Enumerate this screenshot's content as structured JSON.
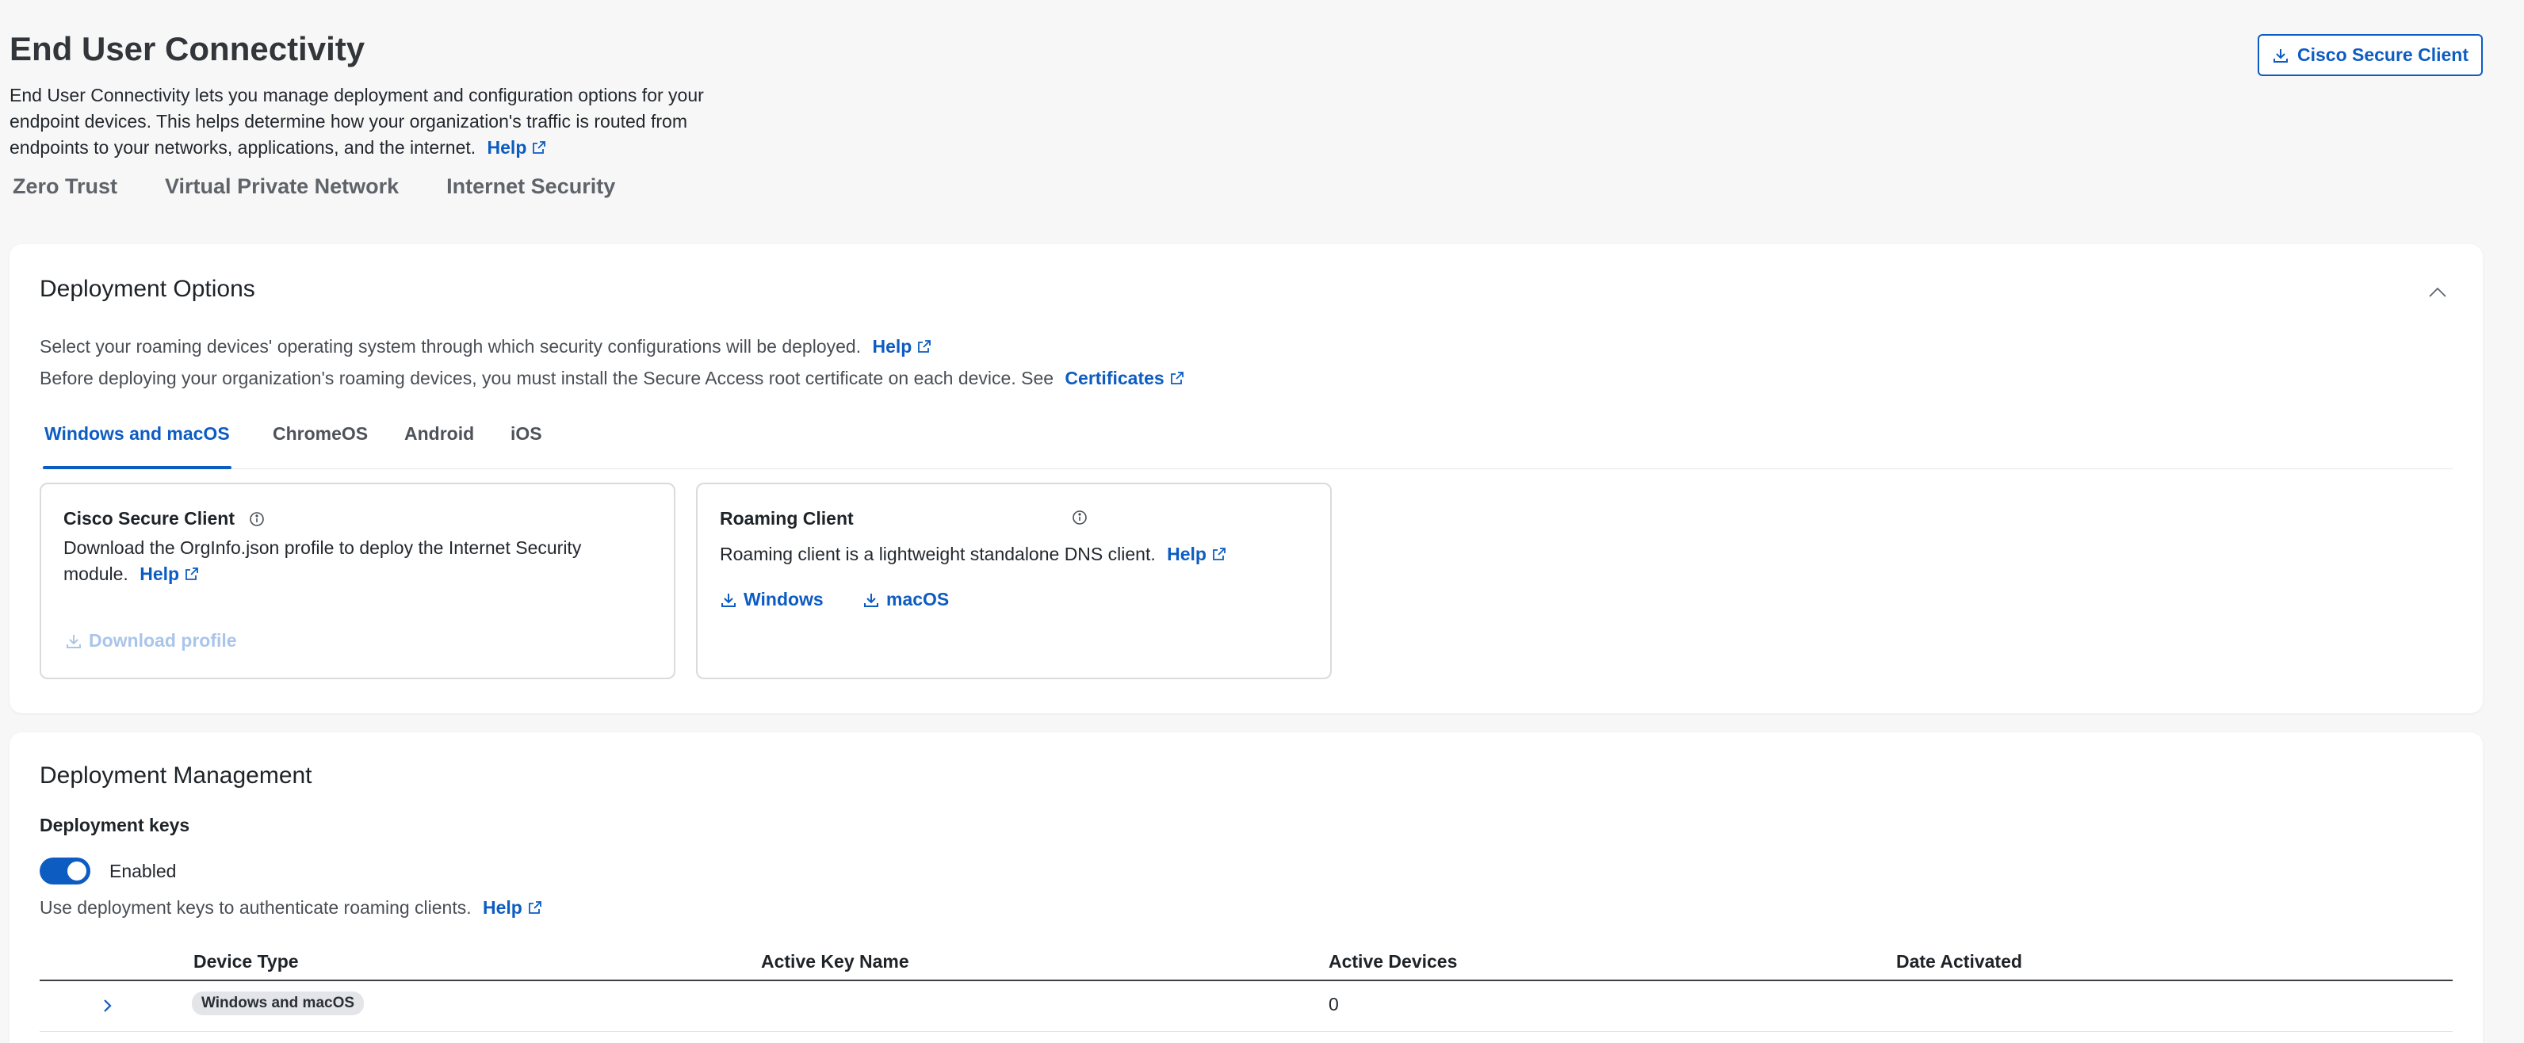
{
  "header": {
    "title": "End User Connectivity",
    "intro_line1": "End User Connectivity lets you manage deployment and configuration options for your",
    "intro_line2": "endpoint devices. This helps determine how your organization's traffic is routed from",
    "intro_line3": "endpoints to your networks, applications, and the internet.",
    "help_label": "Help",
    "client_button_label": "Cisco Secure Client"
  },
  "main_tabs": [
    "Zero Trust",
    "Virtual Private Network",
    "Internet Security"
  ],
  "deployment_options": {
    "title": "Deployment Options",
    "desc1": "Select your roaming devices' operating system through which security configurations will be deployed.",
    "help_label": "Help",
    "desc2": "Before deploying your organization's roaming devices, you must install the Secure Access root certificate on each device. See",
    "certificates_label": "Certificates",
    "os_tabs": [
      "Windows and macOS",
      "ChromeOS",
      "Android",
      "iOS"
    ],
    "cisco_card": {
      "title": "Cisco Secure Client",
      "body_line1": "Download the OrgInfo.json profile to deploy the Internet Security",
      "body_line2": "module.",
      "help_label": "Help",
      "download_label": "Download profile"
    },
    "roaming_card": {
      "title": "Roaming Client",
      "body": "Roaming client is a lightweight standalone DNS client.",
      "help_label": "Help",
      "windows_label": "Windows",
      "macos_label": "macOS"
    }
  },
  "deployment_management": {
    "title": "Deployment Management",
    "keys_heading": "Deployment keys",
    "toggle_label": "Enabled",
    "toggle_on": true,
    "keys_desc": "Use deployment keys to authenticate roaming clients.",
    "help_label": "Help",
    "table": {
      "headers": [
        "Device Type",
        "Active Key Name",
        "Active Devices",
        "Date Activated"
      ],
      "rows": [
        {
          "device_type": "Windows and macOS",
          "active_key_name": "",
          "active_devices": "0",
          "date_activated": ""
        }
      ]
    }
  },
  "colors": {
    "accent": "#0d5cc2",
    "background": "#f7f7f7",
    "card": "#ffffff"
  }
}
